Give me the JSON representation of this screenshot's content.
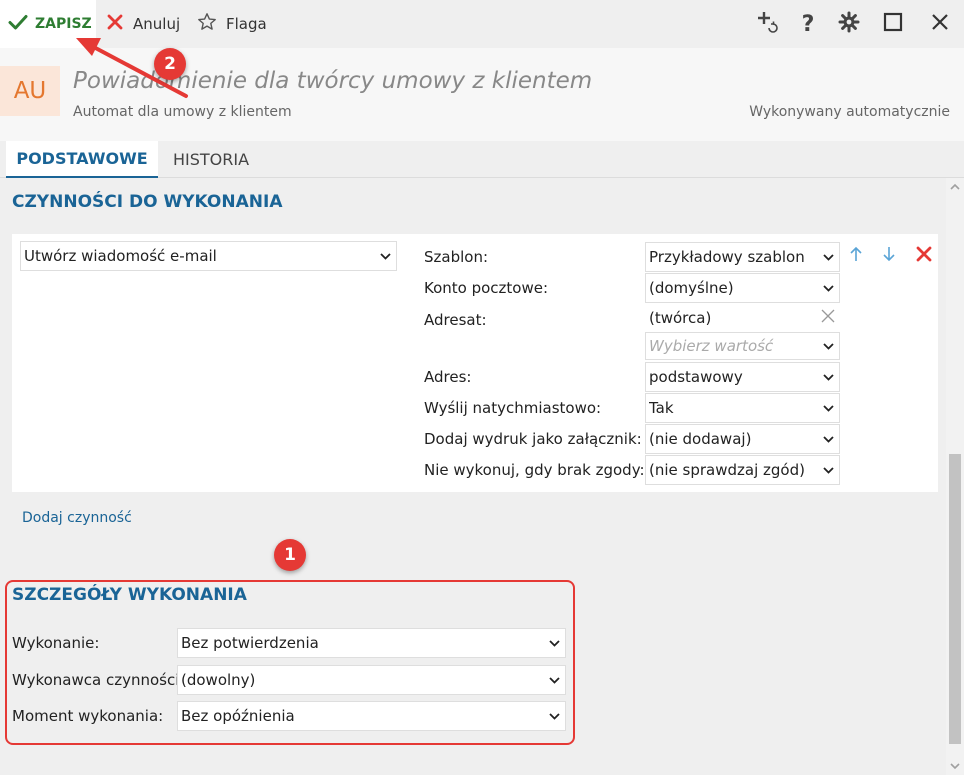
{
  "toolbar": {
    "save_label": "ZAPISZ",
    "cancel_label": "Anuluj",
    "flag_label": "Flaga"
  },
  "header": {
    "avatar": "AU",
    "title": "Powiadomienie dla twórcy umowy z klientem",
    "subtitle": "Automat dla umowy z klientem",
    "status": "Wykonywany automatycznie"
  },
  "tabs": [
    {
      "label": "PODSTAWOWE",
      "active": true
    },
    {
      "label": "HISTORIA",
      "active": false
    }
  ],
  "actions_section": {
    "title": "CZYNNOŚCI DO WYKONANIA",
    "action_type": "Utwórz wiadomość e-mail",
    "fields": {
      "template": {
        "label": "Szablon:",
        "value": "Przykładowy szablon"
      },
      "account": {
        "label": "Konto pocztowe:",
        "value": "(domyślne)"
      },
      "recipient": {
        "label": "Adresat:",
        "value": "(twórca)",
        "placeholder": "Wybierz wartość"
      },
      "address": {
        "label": "Adres:",
        "value": "podstawowy"
      },
      "send_now": {
        "label": "Wyślij natychmiastowo:",
        "value": "Tak"
      },
      "attach_print": {
        "label": "Dodaj wydruk jako załącznik:",
        "value": "(nie dodawaj)"
      },
      "no_consent": {
        "label": "Nie wykonuj, gdy brak zgody:",
        "value": "(nie sprawdzaj zgód)"
      }
    },
    "add_action_link": "Dodaj czynność"
  },
  "execution_section": {
    "title": "SZCZEGÓŁY WYKONANIA",
    "fields": {
      "execution": {
        "label": "Wykonanie:",
        "value": "Bez potwierdzenia"
      },
      "executor": {
        "label": "Wykonawca czynności:",
        "value": "(dowolny)"
      },
      "moment": {
        "label": "Moment wykonania:",
        "value": "Bez opóźnienia"
      }
    }
  },
  "annotations": {
    "badge_1": "1",
    "badge_2": "2"
  },
  "colors": {
    "accent": "#1a6496",
    "save_green": "#2e7d32",
    "danger_red": "#e53935",
    "avatar_bg": "#fbe6d9",
    "avatar_fg": "#e4772f"
  }
}
